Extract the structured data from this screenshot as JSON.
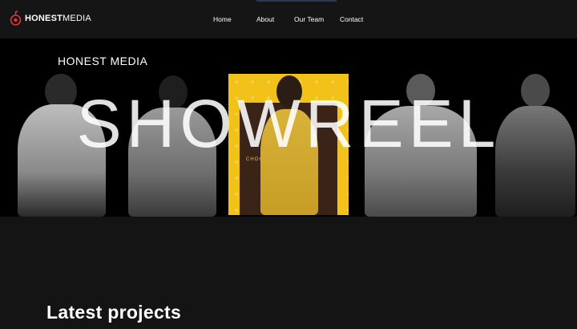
{
  "brand": {
    "name_bold": "HONEST",
    "name_regular": "MEDIA",
    "logo_icon": "rose-logo-icon",
    "accent": "#e0363a"
  },
  "nav": {
    "items": [
      {
        "label": "Home"
      },
      {
        "label": "About"
      },
      {
        "label": "Our Team"
      },
      {
        "label": "Contact"
      }
    ]
  },
  "hero": {
    "kicker": "HONEST MEDIA",
    "headline": "SHOWREEL",
    "panel_color": "#f2c21b",
    "panel_text": "CHOC"
  },
  "projects": {
    "title": "Latest projects"
  }
}
